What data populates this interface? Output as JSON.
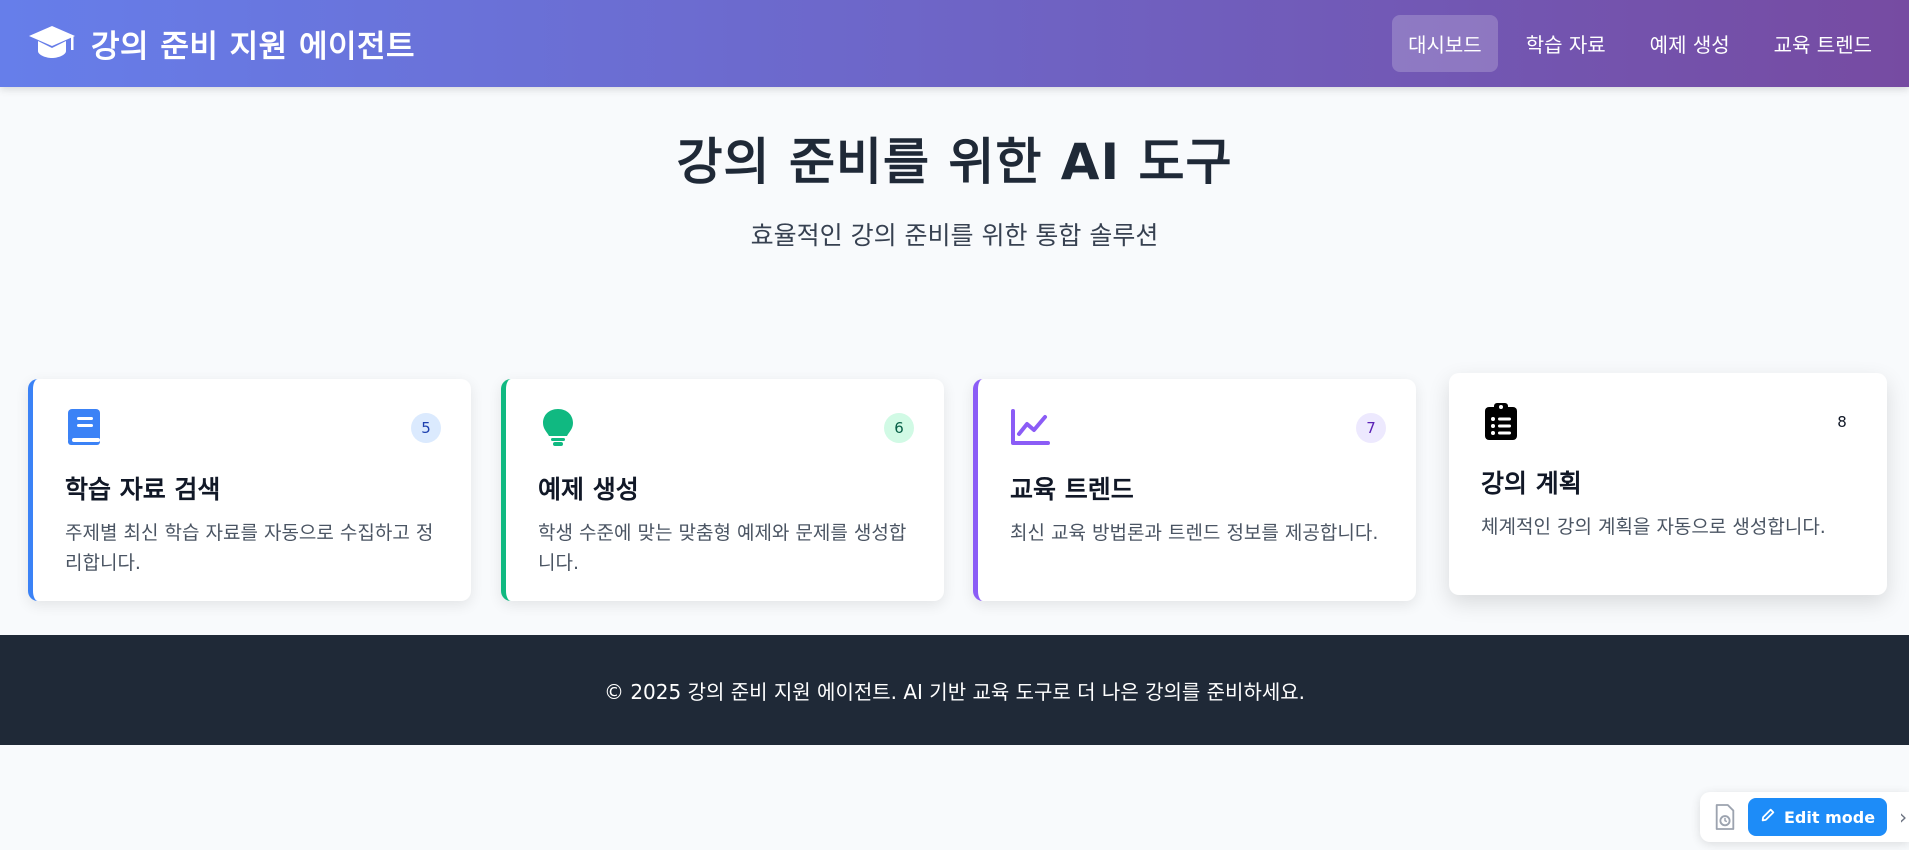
{
  "header": {
    "brand_icon": "graduation-cap-icon",
    "title": "강의 준비 지원 에이전트",
    "nav": [
      {
        "label": "대시보드",
        "active": true
      },
      {
        "label": "학습 자료",
        "active": false
      },
      {
        "label": "예제 생성",
        "active": false
      },
      {
        "label": "교육 트렌드",
        "active": false
      }
    ]
  },
  "hero": {
    "title": "강의 준비를 위한 AI 도구",
    "subtitle": "효율적인 강의 준비를 위한 통합 솔루션"
  },
  "cards": [
    {
      "icon": "book-icon",
      "badge": "5",
      "title": "학습 자료 검색",
      "desc": "주제별 최신 학습 자료를 자동으로 수집하고 정리합니다.",
      "accent": "#3b82f6",
      "badge_bg": "#dbeafe",
      "badge_color": "#1e40af"
    },
    {
      "icon": "lightbulb-icon",
      "badge": "6",
      "title": "예제 생성",
      "desc": "학생 수준에 맞는 맞춤형 예제와 문제를 생성합니다.",
      "accent": "#10b981",
      "badge_bg": "#d1fae5",
      "badge_color": "#065f46"
    },
    {
      "icon": "chart-line-icon",
      "badge": "7",
      "title": "교육 트렌드",
      "desc": "최신 교육 방법론과 트렌드 정보를 제공합니다.",
      "accent": "#8b5cf6",
      "badge_bg": "#ede9fe",
      "badge_color": "#5b21b6"
    },
    {
      "icon": "clipboard-list-icon",
      "badge": "8",
      "title": "강의 계획",
      "desc": "체계적인 강의 계획을 자동으로 생성합니다.",
      "accent": "#000000",
      "badge_bg": "#ffffff",
      "badge_color": "#111827"
    }
  ],
  "footer": {
    "text": "© 2025 강의 준비 지원 에이전트. AI 기반 교육 도구로 더 나은 강의를 준비하세요."
  },
  "editbar": {
    "edit_label": "Edit mode",
    "doc_icon": "document-history-icon",
    "pencil_icon": "pencil-icon",
    "chevron": "›"
  }
}
